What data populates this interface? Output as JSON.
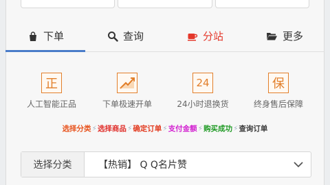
{
  "tabs": [
    {
      "label": "下单",
      "icon": "shopping-bag-icon",
      "active": false
    },
    {
      "label": "查询",
      "icon": "search-icon",
      "active": false
    },
    {
      "label": "分站",
      "icon": "coffee-cup-icon",
      "active": true
    },
    {
      "label": "更多",
      "icon": "folder-open-icon",
      "active": false
    }
  ],
  "features": [
    {
      "badge": "正",
      "label": "人工智能正品"
    },
    {
      "badge": "",
      "label": "下单极速开单"
    },
    {
      "badge": "24",
      "label": "24小时退换货"
    },
    {
      "badge": "保",
      "label": "终身售后保障"
    }
  ],
  "steps": [
    {
      "text": "选择分类",
      "color": "#e8541e"
    },
    {
      "text": "选择商品",
      "color": "#e0302c"
    },
    {
      "text": "确定订单",
      "color": "#e23a1f"
    },
    {
      "text": "支付金额",
      "color": "#d21fd0"
    },
    {
      "text": "购买成功",
      "color": "#1f9a24"
    },
    {
      "text": "查询订单",
      "color": "#3a3a3a"
    }
  ],
  "step_separator": "⚡",
  "category": {
    "label": "选择分类",
    "selected": "【热销】 Q Q名片赞"
  },
  "colors": {
    "active_tab": "#e4372a",
    "underline": "#4a7cc9",
    "feature": "#e27f2a"
  }
}
